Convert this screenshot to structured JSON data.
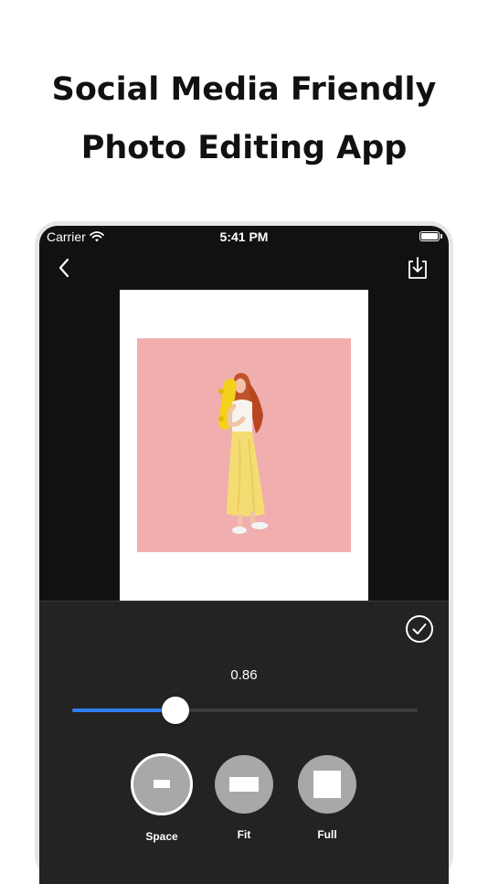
{
  "headline": {
    "line1": "Social Media Friendly",
    "line2": "Photo Editing App"
  },
  "status_bar": {
    "carrier": "Carrier",
    "time": "5:41 PM"
  },
  "nav": {
    "back_icon": "chevron-left-icon",
    "save_icon": "download-icon"
  },
  "editor": {
    "photo_background": "#f0aeae",
    "frame_color": "#ffffff"
  },
  "panel": {
    "confirm_icon": "checkmark-circle-icon",
    "slider": {
      "value_label": "0.86",
      "fill_fraction": 0.3,
      "accent": "#2f7ff0"
    },
    "modes": [
      {
        "label": "Space",
        "selected": true
      },
      {
        "label": "Fit",
        "selected": false
      },
      {
        "label": "Full",
        "selected": false
      }
    ]
  }
}
